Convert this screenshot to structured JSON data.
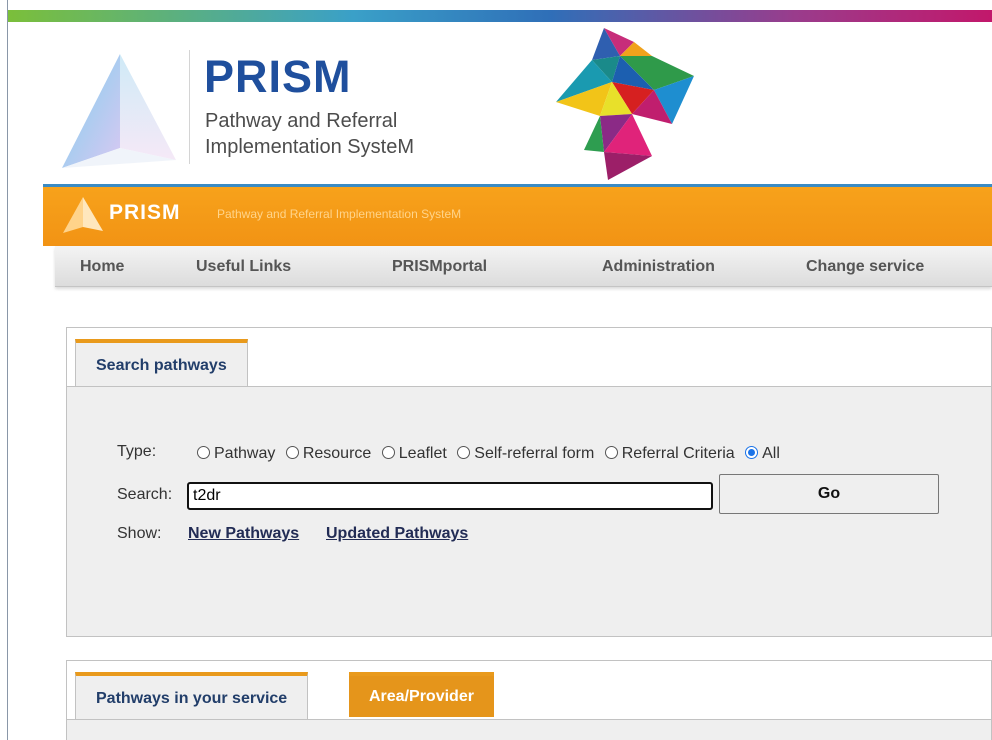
{
  "app": {
    "logo_title": "PRISM",
    "logo_subtitle_line1": "Pathway and Referral",
    "logo_subtitle_line2": "Implementation SysteM"
  },
  "banner": {
    "title": "PRISM",
    "subtitle": "Pathway and Referral Implementation SysteM"
  },
  "nav": {
    "items": [
      "Home",
      "Useful Links",
      "PRISMportal",
      "Administration",
      "Change service"
    ]
  },
  "search_panel": {
    "tab_label": "Search pathways",
    "type_label": "Type:",
    "type_options": [
      "Pathway",
      "Resource",
      "Leaflet",
      "Self-referral form",
      "Referral Criteria",
      "All"
    ],
    "selected_type": "All",
    "search_label": "Search:",
    "search_value": "t2dr",
    "go_label": "Go",
    "show_label": "Show:",
    "show_links": [
      "New Pathways",
      "Updated Pathways"
    ]
  },
  "pathways_panel": {
    "tabs": [
      "Pathways in your service",
      "Area/Provider"
    ],
    "active_tab": "Pathways in your service"
  },
  "colors": {
    "brand_blue": "#1f4f9d",
    "banner_orange": "#f29314",
    "tab_accent": "#e99a1c"
  }
}
